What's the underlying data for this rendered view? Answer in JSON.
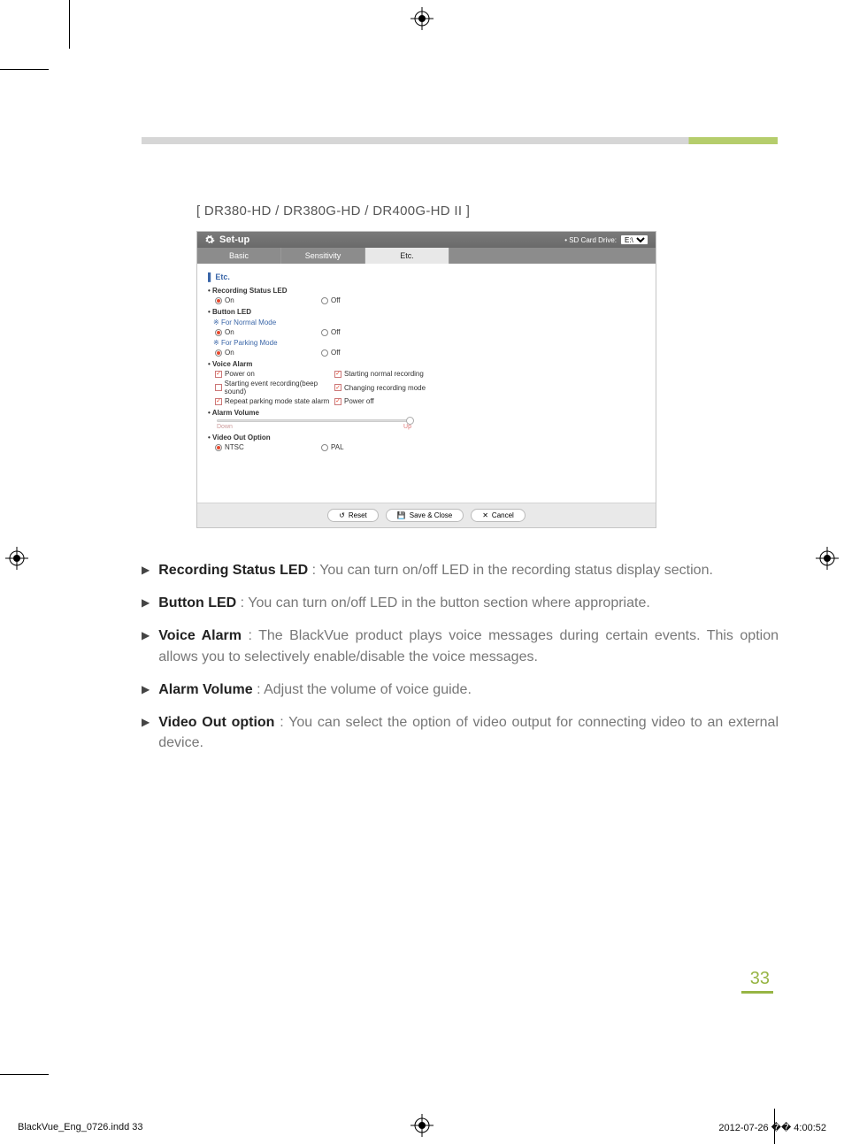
{
  "model_label": "[ DR380-HD / DR380G-HD / DR400G-HD II ]",
  "setup": {
    "title": "Set-up",
    "sd_label": "• SD Card Drive:",
    "sd_value": "E:\\",
    "tabs": {
      "basic": "Basic",
      "sensitivity": "Sensitivity",
      "etc": "Etc."
    },
    "panel_title": "Etc.",
    "rec_led": {
      "head": "Recording Status LED",
      "on": "On",
      "off": "Off"
    },
    "btn_led": {
      "head": "Button LED",
      "normal": "For Normal Mode",
      "parking": "For Parking Mode",
      "on": "On",
      "off": "Off"
    },
    "voice": {
      "head": "Voice Alarm",
      "power_on": "Power on",
      "start_normal": "Starting normal recording",
      "start_event": "Starting event recording(beep sound)",
      "change_mode": "Changing recording mode",
      "repeat_park": "Repeat parking mode state alarm",
      "power_off": "Power off"
    },
    "volume": {
      "head": "Alarm Volume",
      "down": "Down",
      "up": "Up"
    },
    "video_out": {
      "head": "Video Out Option",
      "ntsc": "NTSC",
      "pal": "PAL"
    },
    "buttons": {
      "reset": "Reset",
      "save": "Save & Close",
      "cancel": "Cancel"
    }
  },
  "desc": {
    "rec_led": {
      "t": "Recording Status LED",
      "d": " : You can turn on/off LED in the recording status display section."
    },
    "btn_led": {
      "t": "Button LED",
      "d": " : You can turn on/off LED in the button section where appropriate."
    },
    "voice": {
      "t": "Voice Alarm",
      "d": " : The BlackVue product plays voice messages during certain events. This option allows you to selectively enable/disable the voice messages."
    },
    "volume": {
      "t": "Alarm Volume",
      "d": " : Adjust the volume of voice guide."
    },
    "video": {
      "t": "Video Out option",
      "d": " : You can select the option of video output for connecting video to an external device."
    }
  },
  "page_number": "33",
  "footer": {
    "file": "BlackVue_Eng_0726.indd   33",
    "datetime": "2012-07-26   �� 4:00:52"
  }
}
